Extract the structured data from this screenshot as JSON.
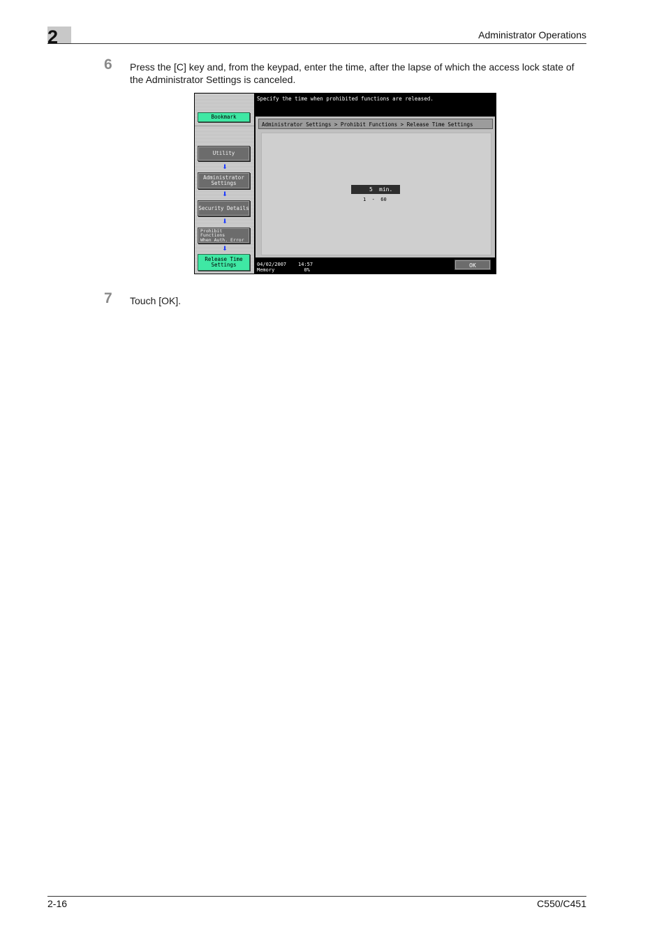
{
  "header": {
    "chapter": "2",
    "title": "Administrator Operations"
  },
  "steps": [
    {
      "num": "6",
      "text_line1": "Press the [C] key and, from the keypad, enter the time, after the lapse of which the access lock state of",
      "text_line2": "the Administrator Settings is canceled."
    },
    {
      "num": "7",
      "text_line1": "Touch [OK]."
    }
  ],
  "screen": {
    "message": "Specify the time when prohibited functions are released.",
    "breadcrumb": "Administrator Settings > Prohibit Functions > Release Time Settings",
    "left_buttons": {
      "bookmark": "Bookmark",
      "utility": "Utility",
      "admin_line1": "Administrator",
      "admin_line2": "Settings",
      "security": "Security Details",
      "prohibit_line1": "Prohibit",
      "prohibit_line2": "Functions",
      "prohibit_line3": "When Auth. Error",
      "release_line1": "Release Time",
      "release_line2": "Settings"
    },
    "value": "5",
    "unit": "min.",
    "range": "1  -  60",
    "status_date": "04/02/2007",
    "status_time": "14:57",
    "status_memory_label": "Memory",
    "status_memory_value": "0%",
    "ok_label": "OK",
    "colors": {
      "active_button": "#3fe8a4",
      "arrow": "#1f3cff"
    }
  },
  "footer": {
    "page": "2-16",
    "model": "C550/C451"
  }
}
